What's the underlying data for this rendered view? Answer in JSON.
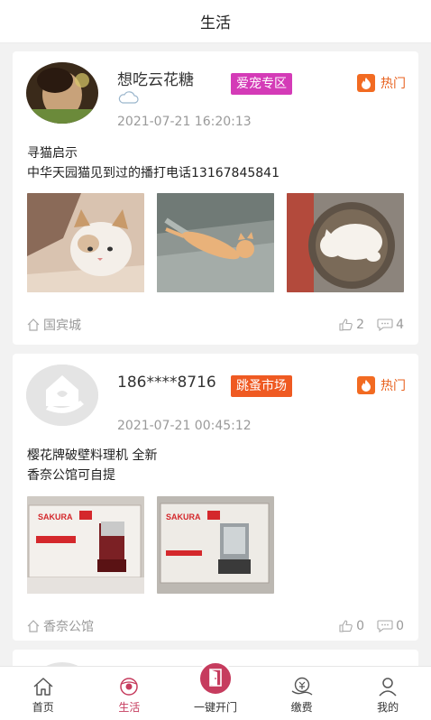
{
  "header": {
    "title": "生活"
  },
  "posts": [
    {
      "author": "想吃云花糖",
      "tag": "爱宠专区",
      "tag_color": "#d43bb7",
      "hot_label": "热门",
      "time": "2021-07-21 16:20:13",
      "content_lines": [
        "寻猫启示",
        "中华天园猫见到过的播打电话13167845841"
      ],
      "location": "国宾城",
      "likes": "2",
      "comments": "4"
    },
    {
      "author": "186****8716",
      "tag": "跳蚤市场",
      "tag_color": "#ef5a22",
      "hot_label": "热门",
      "time": "2021-07-21 00:45:12",
      "content_lines": [
        "樱花牌破壁料理机 全新",
        "香奈公馆可自提"
      ],
      "location": "香奈公馆",
      "likes": "0",
      "comments": "0",
      "photo_brand": "SAKURA"
    }
  ],
  "tabbar": {
    "items": [
      {
        "label": "首页",
        "icon": "home-icon"
      },
      {
        "label": "生活",
        "icon": "life-icon"
      },
      {
        "label": "一键开门",
        "icon": "door-icon"
      },
      {
        "label": "缴费",
        "icon": "payment-icon"
      },
      {
        "label": "我的",
        "icon": "profile-icon"
      }
    ],
    "active_index": 1,
    "accent": "#c63c5e"
  }
}
